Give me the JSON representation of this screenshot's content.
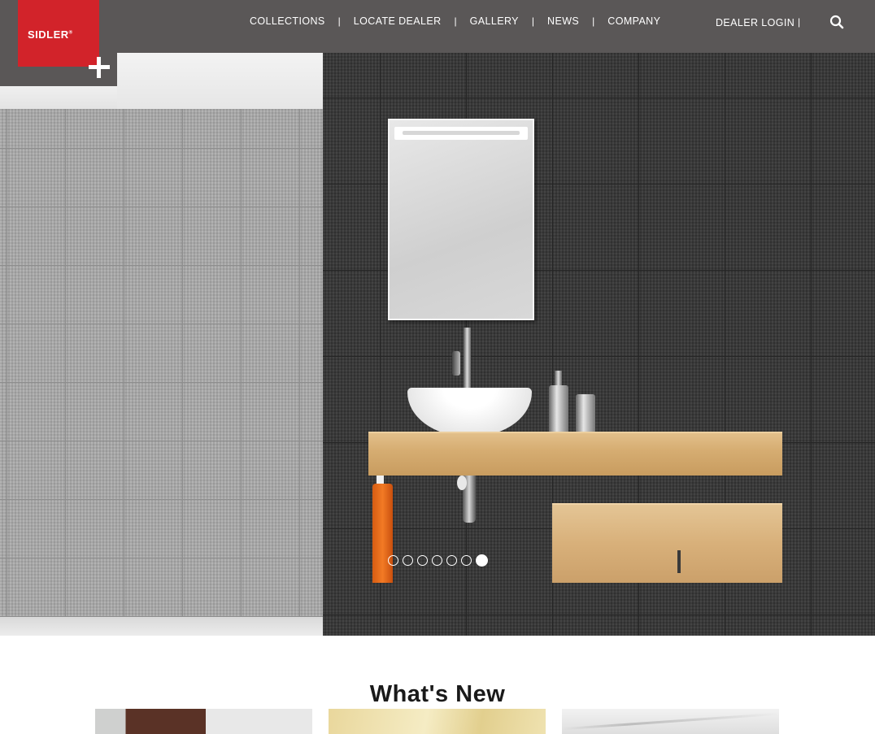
{
  "logo": {
    "text": "SIDLER",
    "registered_mark": "®"
  },
  "nav": {
    "items": [
      {
        "label": "COLLECTIONS"
      },
      {
        "label": "LOCATE DEALER"
      },
      {
        "label": "GALLERY"
      },
      {
        "label": "NEWS"
      },
      {
        "label": "COMPANY"
      }
    ],
    "separator": "|"
  },
  "header": {
    "dealer_login_label": "DEALER LOGIN",
    "separator": "|",
    "search_icon": "search-icon"
  },
  "hero": {
    "slide_count": 7,
    "active_slide": 7
  },
  "whats_new": {
    "title": "What's New"
  },
  "colors": {
    "header_bg": "#5a5757",
    "brand_red": "#d2232a"
  }
}
